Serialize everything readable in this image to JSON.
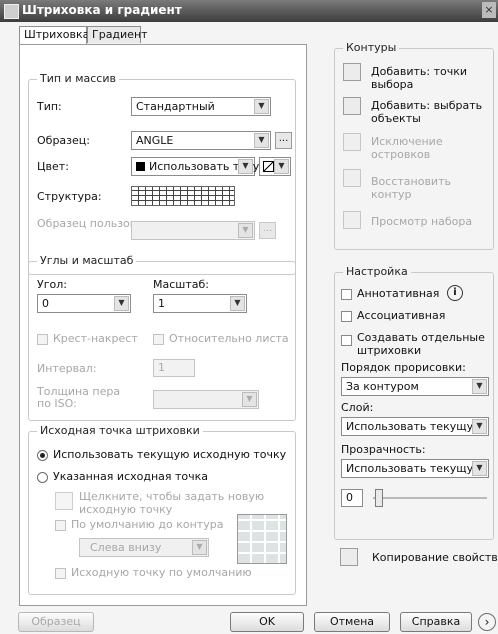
{
  "window": {
    "title": "Штриховка и градиент",
    "close": "×"
  },
  "tabs": [
    {
      "label": "Штриховка"
    },
    {
      "label": "Градиент"
    }
  ],
  "type_pattern": {
    "legend": "Тип и массив",
    "type_label": "Тип:",
    "type_value": "Стандартный",
    "pattern_label": "Образец:",
    "pattern_value": "ANGLE",
    "pattern_button": "...",
    "color_label": "Цвет:",
    "color_value": "Использовать теку",
    "color_swatch": "#000000",
    "structure_label": "Структура:",
    "custom_label": "Образец пользователя:",
    "custom_button": "...",
    "custom_value": ""
  },
  "angle_scale": {
    "legend": "Углы и масштаб",
    "angle_label": "Угол:",
    "angle_value": "0",
    "scale_label": "Масштаб:",
    "scale_value": "1",
    "double_label": "Крест-накрест",
    "relative_label": "Относительно листа",
    "spacing_label": "Интервал:",
    "spacing_value": "1",
    "iso_label": "Толщина пера по ISO:",
    "iso_value": ""
  },
  "origin": {
    "legend": "Исходная точка штриховки",
    "use_current": "Использовать текущую исходную точку",
    "specified": "Указанная исходная точка",
    "click_set": "Щелкните, чтобы задать новую исходную точку",
    "default_extents": "По умолчанию до контура",
    "position_value": "Слева внизу",
    "store_default": "Исходную точку по умолчанию"
  },
  "boundaries": {
    "legend": "Контуры",
    "add_pick": "Добавить: точки выбора",
    "add_select": "Добавить: выбрать объекты",
    "remove": "Исключение островков",
    "recreate": "Восстановить контур",
    "view": "Просмотр набора"
  },
  "options": {
    "legend": "Настройка",
    "annotative": "Аннотативная",
    "associative": "Ассоциативная",
    "separate": "Создавать отдельные штриховки",
    "draw_order_label": "Порядок прорисовки:",
    "draw_order_value": "За контуром",
    "layer_label": "Слой:",
    "layer_value": "Использовать текущую",
    "transparency_label": "Прозрачность:",
    "transparency_value": "Использовать текущую",
    "transparency_amount": "0",
    "info_icon": "i"
  },
  "inherit": {
    "label": "Копирование свойств"
  },
  "footer": {
    "preview": "Образец",
    "ok": "OK",
    "cancel": "Отмена",
    "help": "Справка",
    "more": "›"
  }
}
